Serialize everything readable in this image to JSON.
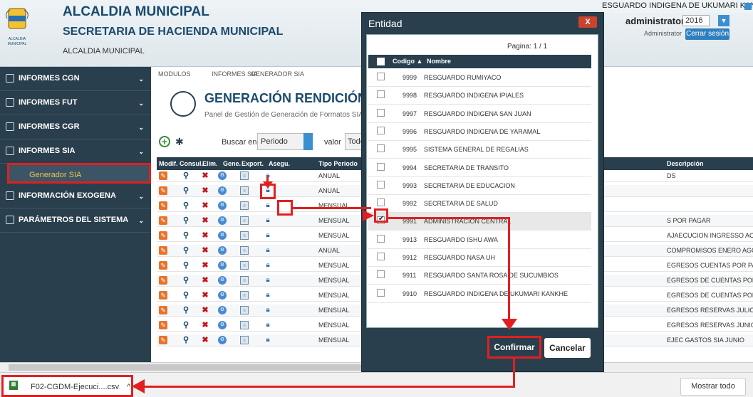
{
  "header": {
    "title1": "ALCALDIA MUNICIPAL",
    "title2": "SECRETARIA DE HACIENDA MUNICIPAL",
    "title3": "ALCALDIA MUNICIPAL",
    "logo_text": "ALCALDIA MUNICIPAL",
    "entity": "ESGUARDO INDIGENA DE UKUMARI KANKHE",
    "user": "administrator",
    "year": "2016",
    "role": "Administrator",
    "logout": "Cerrar sesión"
  },
  "sidebar": {
    "items": [
      {
        "label": "INFORMES CGN"
      },
      {
        "label": "INFORMES FUT"
      },
      {
        "label": "INFORMES CGR"
      },
      {
        "label": "INFORMES SIA"
      },
      {
        "label": "INFORMACIÓN EXOGENA"
      },
      {
        "label": "PARÁMETROS DEL SISTEMA"
      }
    ],
    "active_sub": "Generador SIA"
  },
  "breadcrumb": {
    "a": "MODULOS",
    "b": "INFORMES SIA",
    "c": "GENERADOR SIA"
  },
  "page": {
    "title": "GENERACIÓN RENDICIÓN SIA",
    "subtitle": "Panel de Gestión de Generación de Formatos SIA"
  },
  "search": {
    "label": "Buscar en",
    "field": "Periodo",
    "value_label": "valor",
    "value": "Todo"
  },
  "table": {
    "headers": {
      "modif": "Modif.",
      "consul": "Consul.",
      "elim": "Elim.",
      "gene": "Gene.",
      "export": "Export.",
      "asegu": "Asegu.",
      "tipo": "Tipo Periodo",
      "desc": "Descripción"
    },
    "rows": [
      {
        "tipo": "ANUAL",
        "desc": "DS"
      },
      {
        "tipo": "ANUAL",
        "desc": ""
      },
      {
        "tipo": "MENSUAL",
        "desc": ""
      },
      {
        "tipo": "MENSUAL",
        "desc": "S POR PAGAR"
      },
      {
        "tipo": "MENSUAL",
        "desc": "AJAECUCION INGRESSO ACUMU"
      },
      {
        "tipo": "ANUAL",
        "desc": "COMPROMISOS ENERO AGOSTO"
      },
      {
        "tipo": "MENSUAL",
        "desc": "EGRESOS CUENTAS POR PAGAR"
      },
      {
        "tipo": "MENSUAL",
        "desc": "EGRESOS DE CUENTAS POR PAG"
      },
      {
        "tipo": "MENSUAL",
        "desc": "EGRESOS DE CUENTAS POR PAG"
      },
      {
        "tipo": "MENSUAL",
        "desc": "EGRESOS RESERVAS JULIO"
      },
      {
        "tipo": "MENSUAL",
        "desc": "EGRESOS RESERVAS JUNIO"
      },
      {
        "tipo": "MENSUAL",
        "desc": "EJEC GASTOS SIA JUNIO"
      }
    ]
  },
  "modal": {
    "title": "Entidad",
    "close": "X",
    "pager": "Pagina: 1 / 1",
    "col_code": "Codigo ▲",
    "col_name": "Nombre",
    "rows": [
      {
        "code": "9999",
        "name": "RESGUARDO RUMIYACO"
      },
      {
        "code": "9998",
        "name": "RESGUARDO INDIGENA IPIALES"
      },
      {
        "code": "9997",
        "name": "RESGUARDO INDIGENA SAN JUAN"
      },
      {
        "code": "9996",
        "name": "RESGUARDO INDIGENA DE YARAMAL"
      },
      {
        "code": "9995",
        "name": "SISTEMA GENERAL DE REGALIAS"
      },
      {
        "code": "9994",
        "name": "SECRETARIA DE TRANSITO"
      },
      {
        "code": "9993",
        "name": "SECRETARIA DE EDUCACION"
      },
      {
        "code": "9992",
        "name": "SECRETARIA DE SALUD"
      },
      {
        "code": "9991",
        "name": "ADMINISTRACION CENTRAL"
      },
      {
        "code": "9913",
        "name": "RESGUARDO ISHU AWA"
      },
      {
        "code": "9912",
        "name": "RESGUARDO NASA UH"
      },
      {
        "code": "9911",
        "name": "RESGUARDO SANTA ROSA DE SUCUMBIOS"
      },
      {
        "code": "9910",
        "name": "RESGUARDO INDIGENA DE UKUMARI KANKHE"
      }
    ],
    "confirm": "Confirmar",
    "cancel": "Cancelar"
  },
  "download": {
    "file": "F02-CGDM-Ejecuci....csv",
    "chevron": "^",
    "show_all": "Mostrar todo"
  },
  "colors": {
    "dark": "#2a3f4d",
    "accent": "#3a8fd0",
    "annotation": "#e02020"
  }
}
